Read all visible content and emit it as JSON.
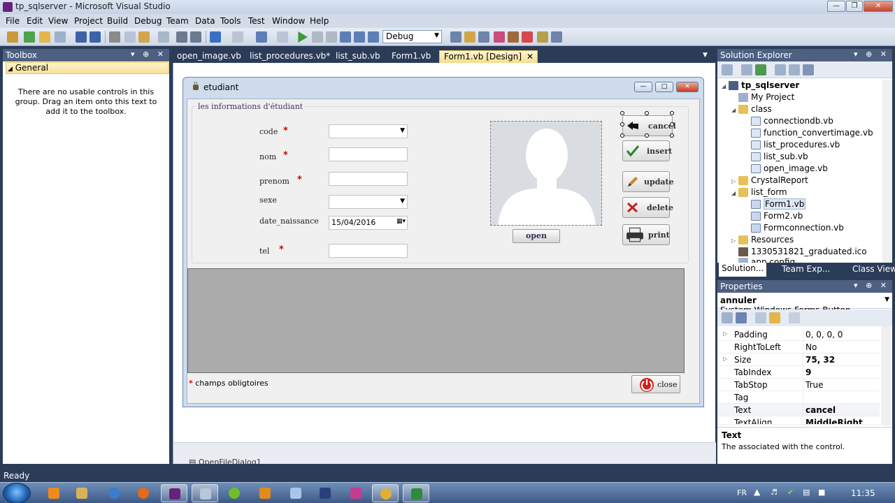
{
  "window": {
    "title": "tp_sqlserver - Microsoft Visual Studio"
  },
  "menu": [
    "File",
    "Edit",
    "View",
    "Project",
    "Build",
    "Debug",
    "Team",
    "Data",
    "Tools",
    "Test",
    "Window",
    "Help"
  ],
  "toolbar": {
    "configuration": "Debug"
  },
  "toolbox": {
    "title": "Toolbox",
    "group": "General",
    "empty_message": "There are no usable controls in this group. Drag an item onto this text to add it to the toolbox."
  },
  "doc_tabs": [
    "open_image.vb",
    "list_procedures.vb*",
    "list_sub.vb",
    "Form1.vb",
    "Form1.vb [Design]"
  ],
  "form": {
    "title": "etudiant",
    "group_title": "les informations d'étudiant",
    "fields": {
      "code": "code",
      "nom": "nom",
      "prenom": "prenom",
      "sexe": "sexe",
      "date_naissance": "date_naissance",
      "tel": "tel"
    },
    "required_mark": "*",
    "date_value": "15/04/2016",
    "buttons": {
      "cancel": "cancel",
      "insert": "insert",
      "update": "update",
      "delete": "delete",
      "print": "print",
      "open": "open",
      "close": "close"
    },
    "legend": "champs obligtoires"
  },
  "tray": {
    "item": "OpenFileDialog1"
  },
  "solution_explorer": {
    "title": "Solution Explorer",
    "items": [
      {
        "label": "tp_sqlserver",
        "bold": true
      },
      {
        "label": "My Project"
      },
      {
        "label": "class"
      },
      {
        "label": "connectiondb.vb"
      },
      {
        "label": "function_convertimage.vb"
      },
      {
        "label": "list_procedures.vb"
      },
      {
        "label": "list_sub.vb"
      },
      {
        "label": "open_image.vb"
      },
      {
        "label": "CrystalReport"
      },
      {
        "label": "list_form"
      },
      {
        "label": "Form1.vb"
      },
      {
        "label": "Form2.vb"
      },
      {
        "label": "Formconnection.vb"
      },
      {
        "label": "Resources"
      },
      {
        "label": "1330531821_graduated.ico"
      },
      {
        "label": "app.config"
      }
    ],
    "tabs": [
      "Solution...",
      "Team Exp...",
      "Class View"
    ]
  },
  "properties": {
    "title": "Properties",
    "object_name": "annuler",
    "object_type": "System.Windows.Forms.Button",
    "rows": [
      {
        "name": "Padding",
        "value": "0, 0, 0, 0",
        "bold": false
      },
      {
        "name": "RightToLeft",
        "value": "No",
        "bold": false
      },
      {
        "name": "Size",
        "value": "75, 32",
        "bold": true
      },
      {
        "name": "TabIndex",
        "value": "9",
        "bold": true
      },
      {
        "name": "TabStop",
        "value": "True",
        "bold": false
      },
      {
        "name": "Tag",
        "value": "",
        "bold": false
      },
      {
        "name": "Text",
        "value": "cancel",
        "bold": true
      },
      {
        "name": "TextAlign",
        "value": "MiddleRight",
        "bold": true
      }
    ],
    "desc_title": "Text",
    "desc_text": "The associated with the control."
  },
  "status": {
    "text": "Ready"
  },
  "taskbar": {
    "language": "FR",
    "time": "11:35"
  }
}
